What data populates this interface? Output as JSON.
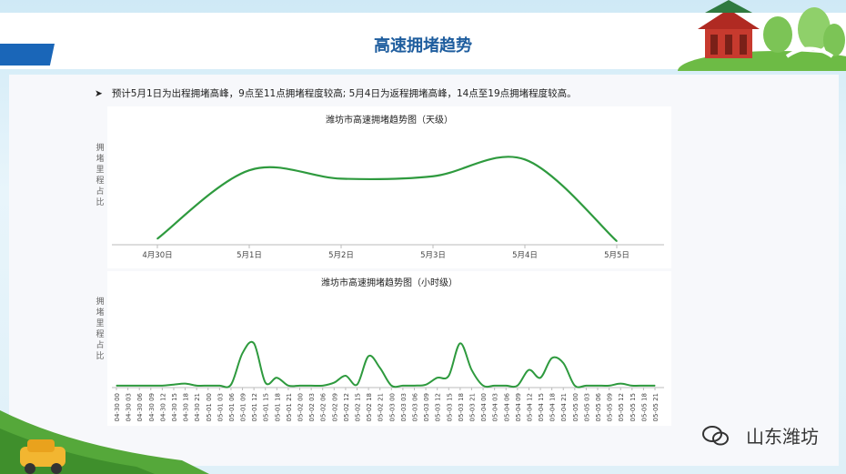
{
  "page": {
    "title": "高速拥堵趋势",
    "bullet": "预计5月1日为出程拥堵高峰，9点至11点拥堵程度较高; 5月4日为返程拥堵高峰，14点至19点拥堵程度较高。",
    "watermark": "山东潍坊"
  },
  "colors": {
    "line": "#2e9a3e",
    "title": "#1e5d9e",
    "stripe": "#1a66b8"
  },
  "chart_data": [
    {
      "type": "line",
      "title": "潍坊市高速拥堵趋势图（天级）",
      "ylabel": "拥堵里程占比",
      "categories": [
        "4月30日",
        "5月1日",
        "5月2日",
        "5月3日",
        "5月4日",
        "5月5日"
      ],
      "values": [
        0.05,
        0.62,
        0.55,
        0.57,
        0.71,
        0.03
      ],
      "ylim": [
        0,
        1
      ],
      "grid": false
    },
    {
      "type": "line",
      "title": "潍坊市高速拥堵趋势图（小时级）",
      "ylabel": "拥堵里程占比",
      "categories": [
        "04-30 00",
        "04-30 03",
        "04-30 06",
        "04-30 09",
        "04-30 12",
        "04-30 15",
        "04-30 18",
        "04-30 21",
        "05-01 00",
        "05-01 03",
        "05-01 06",
        "05-01 09",
        "05-01 12",
        "05-01 15",
        "05-01 18",
        "05-01 21",
        "05-02 00",
        "05-02 03",
        "05-02 06",
        "05-02 09",
        "05-02 12",
        "05-02 15",
        "05-02 18",
        "05-02 21",
        "05-03 00",
        "05-03 03",
        "05-03 06",
        "05-03 09",
        "05-03 12",
        "05-03 15",
        "05-03 18",
        "05-03 21",
        "05-04 00",
        "05-04 03",
        "05-04 06",
        "05-04 09",
        "05-04 12",
        "05-04 15",
        "05-04 18",
        "05-04 21",
        "05-05 00",
        "05-05 03",
        "05-05 06",
        "05-05 09",
        "05-05 12",
        "05-05 15",
        "05-05 18",
        "05-05 21"
      ],
      "values": [
        0.02,
        0.02,
        0.02,
        0.02,
        0.02,
        0.03,
        0.04,
        0.02,
        0.02,
        0.02,
        0.03,
        0.35,
        0.45,
        0.05,
        0.1,
        0.02,
        0.02,
        0.02,
        0.02,
        0.05,
        0.12,
        0.03,
        0.32,
        0.2,
        0.02,
        0.02,
        0.02,
        0.03,
        0.1,
        0.12,
        0.45,
        0.18,
        0.02,
        0.02,
        0.02,
        0.02,
        0.18,
        0.1,
        0.3,
        0.25,
        0.02,
        0.02,
        0.02,
        0.02,
        0.04,
        0.02,
        0.02,
        0.02
      ],
      "ylim": [
        0,
        1
      ],
      "grid": false
    }
  ]
}
